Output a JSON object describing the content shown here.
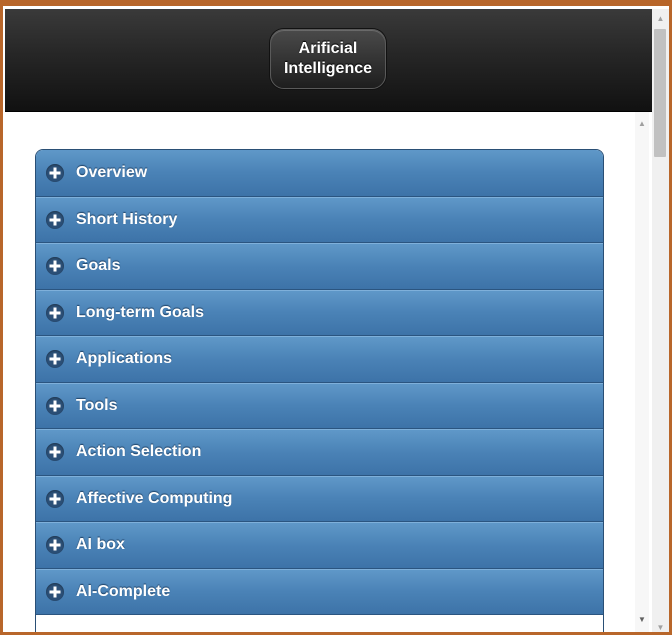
{
  "header": {
    "title": "Arificial Intelligence"
  },
  "topics": [
    {
      "label": "Overview"
    },
    {
      "label": "Short History"
    },
    {
      "label": "Goals"
    },
    {
      "label": "Long-term Goals"
    },
    {
      "label": "Applications"
    },
    {
      "label": "Tools"
    },
    {
      "label": "Action Selection"
    },
    {
      "label": "Affective Computing"
    },
    {
      "label": "AI box"
    },
    {
      "label": "AI-Complete"
    }
  ],
  "icons": {
    "expand": "plus-circle-icon",
    "scroll_up": "arrow-up-icon",
    "scroll_down": "arrow-down-icon"
  },
  "colors": {
    "accent": "#4a82b6",
    "header": "#1e1e1e",
    "frame": "#b8662a"
  }
}
